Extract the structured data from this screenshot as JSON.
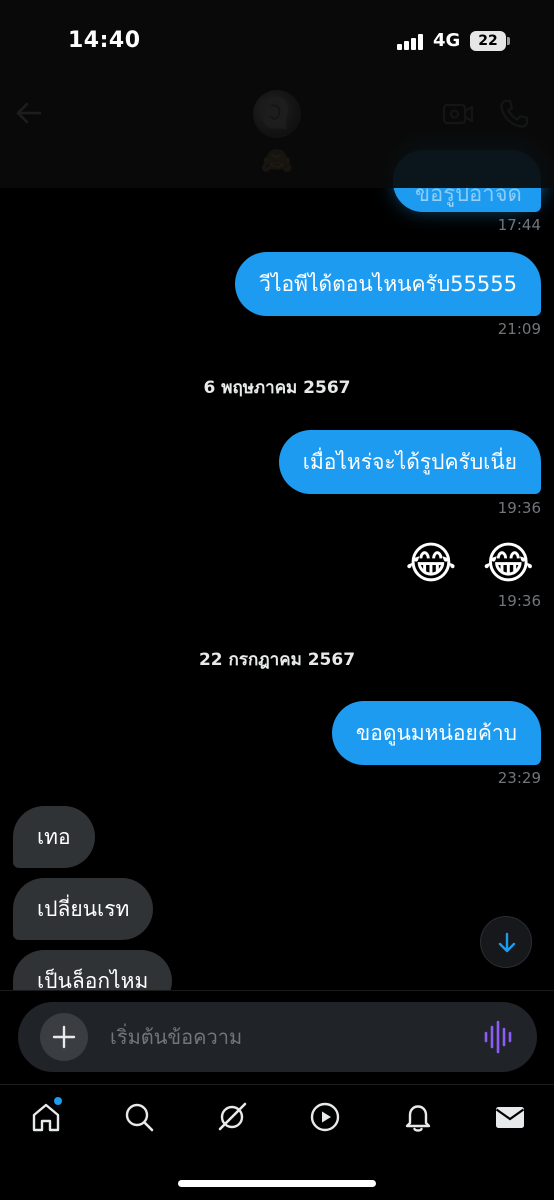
{
  "status_bar": {
    "time": "14:40",
    "network": "4G",
    "battery": "22"
  },
  "header": {
    "name_emoji": "🙈",
    "icons": [
      "back-arrow-icon",
      "video-call-icon",
      "phone-call-icon"
    ]
  },
  "messages": {
    "partial_text": "ขอรูปอาจด",
    "partial_time": "17:44",
    "msg1_text": "วีไอพีได้ตอนไหนครับ55555",
    "msg1_time": "21:09",
    "date1": "6 พฤษภาคม 2567",
    "msg2_text": "เมื่อไหร่จะได้รูปครับเนี่ย",
    "msg2_time": "19:36",
    "msg3_emoji": "😂 😂",
    "msg3_time": "19:36",
    "date2": "22 กรกฎาคม 2567",
    "msg4_text": "ขอดูนมหน่อยค้าบ",
    "msg4_time": "23:29",
    "in1_text": "เทอ",
    "in2_text": "เปลี่ยนเรท",
    "in3_text": "เป็นล็อกไหม"
  },
  "composer": {
    "placeholder": "เริ่มต้นข้อความ"
  },
  "nav": {
    "items": [
      "home-icon",
      "search-icon",
      "grok-icon",
      "video-icon",
      "notifications-icon",
      "messages-icon"
    ]
  },
  "colors": {
    "accent": "#1d9bf0",
    "incoming_bubble": "#2f3336",
    "muted_text": "#71767b",
    "voice_purple": "#8b5cf6"
  }
}
